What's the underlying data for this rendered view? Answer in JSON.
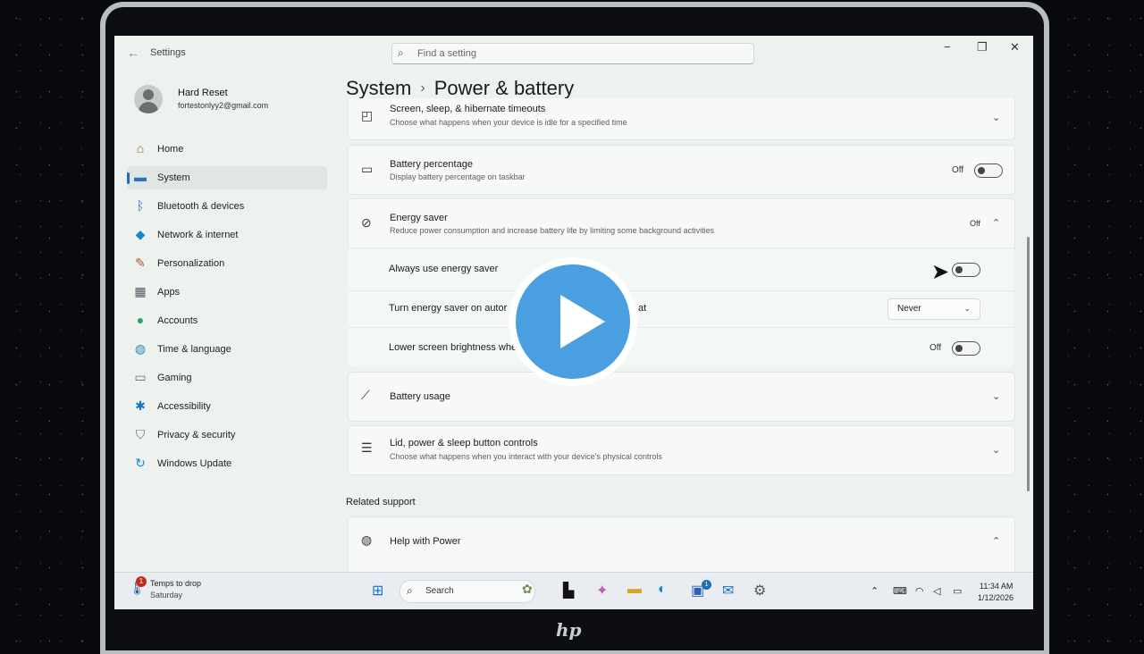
{
  "window": {
    "title": "Settings",
    "search_placeholder": "Find a setting"
  },
  "profile": {
    "name": "Hard Reset",
    "email": "fortestonlyy2@gmail.com"
  },
  "nav": [
    {
      "label": "Home",
      "icon": "home-icon",
      "active": false
    },
    {
      "label": "System",
      "icon": "system-icon",
      "active": true
    },
    {
      "label": "Bluetooth & devices",
      "icon": "bluetooth-icon",
      "active": false
    },
    {
      "label": "Network & internet",
      "icon": "network-icon",
      "active": false
    },
    {
      "label": "Personalization",
      "icon": "brush-icon",
      "active": false
    },
    {
      "label": "Apps",
      "icon": "apps-icon",
      "active": false
    },
    {
      "label": "Accounts",
      "icon": "accounts-icon",
      "active": false
    },
    {
      "label": "Time & language",
      "icon": "globe-icon",
      "active": false
    },
    {
      "label": "Gaming",
      "icon": "gamepad-icon",
      "active": false
    },
    {
      "label": "Accessibility",
      "icon": "accessibility-icon",
      "active": false
    },
    {
      "label": "Privacy & security",
      "icon": "shield-icon",
      "active": false
    },
    {
      "label": "Windows Update",
      "icon": "update-icon",
      "active": false
    }
  ],
  "breadcrumb": {
    "parent": "System",
    "separator": "›",
    "current": "Power & battery"
  },
  "cards": {
    "screen_sleep": {
      "title": "Screen, sleep, & hibernate timeouts",
      "subtitle": "Choose what happens when your device is idle for a specified time"
    },
    "battery_percentage": {
      "title": "Battery percentage",
      "subtitle": "Display battery percentage on taskbar",
      "state": "Off"
    },
    "energy_saver": {
      "title": "Energy saver",
      "subtitle": "Reduce power consumption and increase battery life by limiting some background activities",
      "state": "Off"
    },
    "always_energy_saver": {
      "title": "Always use energy saver"
    },
    "auto_energy_saver": {
      "title": "Turn energy saver on autor",
      "title_tail": "at",
      "value": "Never"
    },
    "lower_brightness": {
      "title": "Lower screen brightness whe",
      "state": "Off"
    },
    "battery_usage": {
      "title": "Battery usage"
    },
    "lid_controls": {
      "title": "Lid, power & sleep button controls",
      "subtitle": "Choose what happens when you interact with your device's physical controls"
    }
  },
  "related": {
    "heading": "Related support",
    "help_title": "Help with Power"
  },
  "taskbar": {
    "weather_badge": "1",
    "weather_line1": "Temps to drop",
    "weather_line2": "Saturday",
    "search_placeholder": "Search",
    "store_badge": "1",
    "time": "11:34 AM",
    "date": "1/12/2026"
  },
  "brand": "hp",
  "colors": {
    "accent": "#1f6fb5",
    "play_button": "#4a9fe0",
    "window_bg": "#edf2ef"
  }
}
